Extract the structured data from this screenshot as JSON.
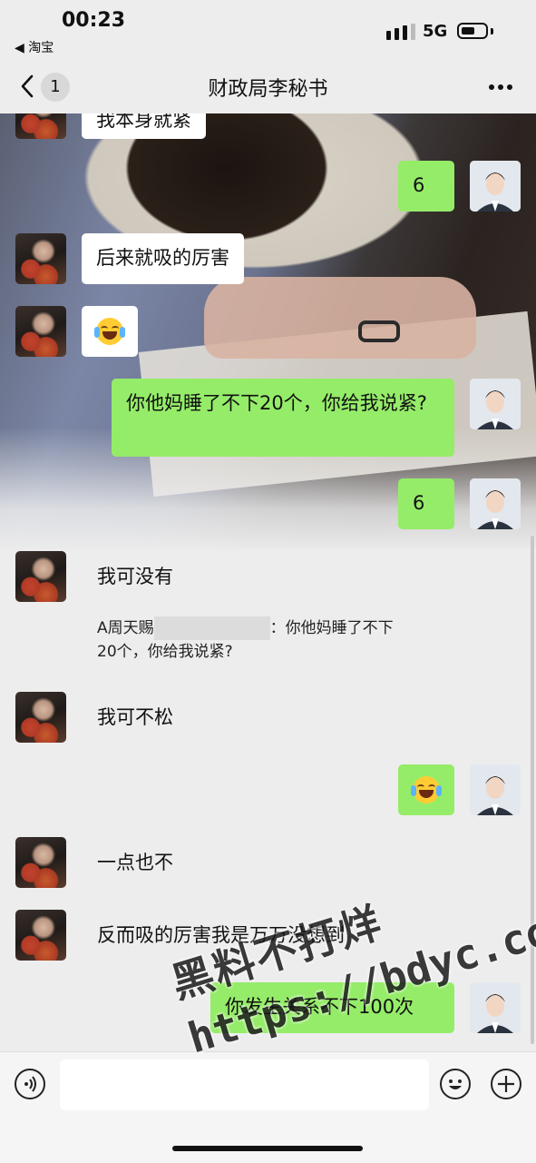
{
  "status_bar": {
    "time": "00:23",
    "back_app": "◀ 淘宝",
    "network": "5G"
  },
  "nav": {
    "unread_count": "1",
    "title": "财政局李秘书"
  },
  "messages": [
    {
      "side": "left",
      "text": "我本身就紧"
    },
    {
      "side": "right",
      "text": "6"
    },
    {
      "side": "left",
      "text": "后来就吸的厉害"
    },
    {
      "side": "left",
      "emoji": "tears-of-joy"
    },
    {
      "side": "right",
      "text": "你他妈睡了不下20个，你给我说紧?"
    },
    {
      "side": "right",
      "text": "6"
    },
    {
      "side": "left",
      "text": "我可没有",
      "quote": {
        "sender": "A周天赐",
        "sep": "：",
        "text1": "你他妈睡了不下",
        "text2": "20个，你给我说紧?"
      }
    },
    {
      "side": "left",
      "text": "我可不松"
    },
    {
      "side": "right",
      "emoji": "tears-of-joy"
    },
    {
      "side": "left",
      "text": "一点也不"
    },
    {
      "side": "left",
      "text": "反而吸的厉害我是万万没想到"
    },
    {
      "side": "right",
      "text": "你发生关系不下100次"
    }
  ],
  "watermark": {
    "line1": "黑料不打烊",
    "line2": "https://bdyc.co"
  },
  "colors": {
    "bubble_green": "#95ec69",
    "bubble_white": "#ffffff",
    "background": "#ededed"
  }
}
